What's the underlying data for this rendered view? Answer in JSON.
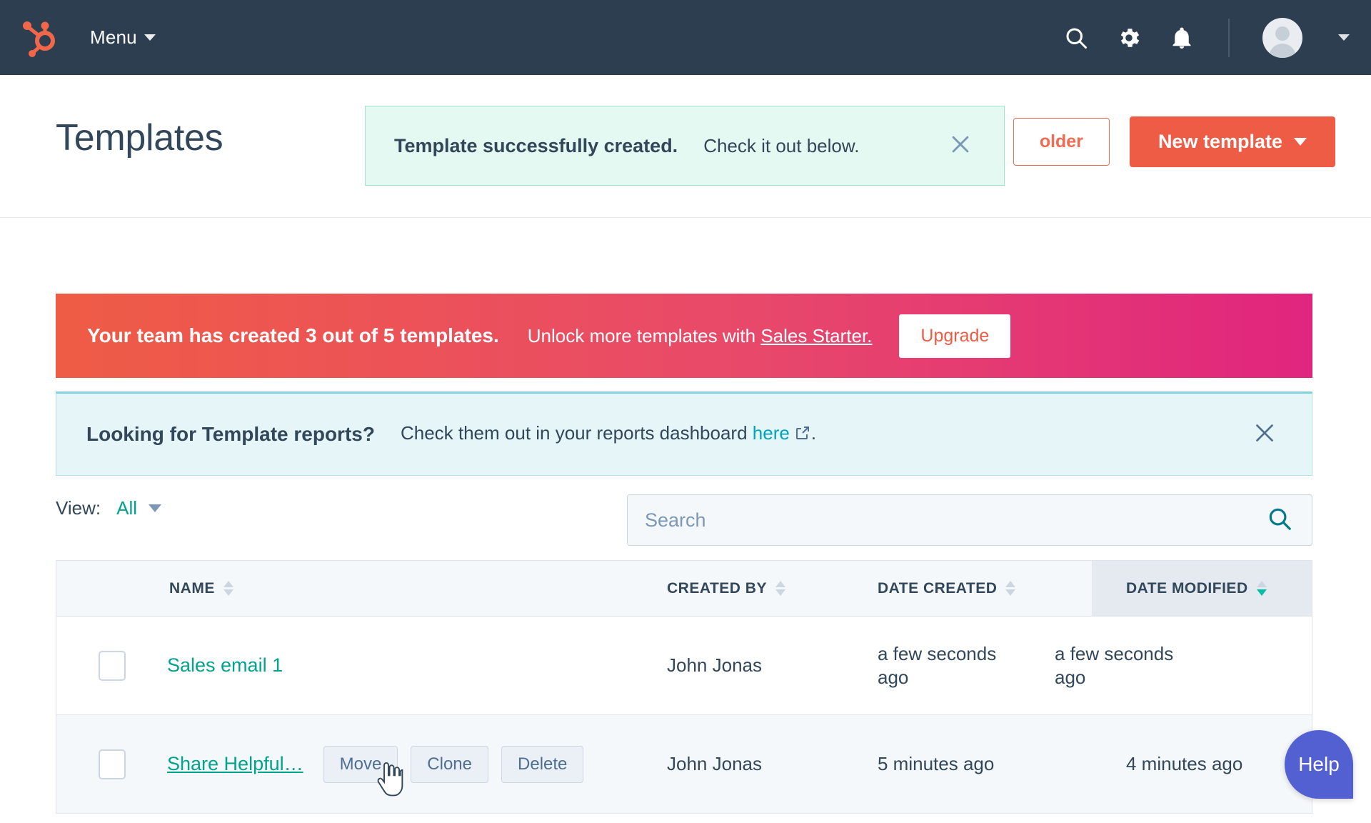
{
  "topnav": {
    "logo": "hubspot-sprocket-logo",
    "menu_label": "Menu",
    "icons": [
      "search-icon",
      "gear-icon",
      "bell-icon"
    ],
    "avatar": "user-avatar"
  },
  "header": {
    "title": "Templates",
    "new_folder_label": "older",
    "new_template_label": "New template"
  },
  "toast": {
    "strong": "Template successfully created.",
    "message": "Check it out below."
  },
  "promo": {
    "strong": "Your team has created 3 out of 5 templates.",
    "text": "Unlock more templates with",
    "link": "Sales Starter.",
    "button": "Upgrade"
  },
  "info": {
    "strong": "Looking for Template reports?",
    "text": "Check them out in your reports dashboard",
    "link": "here",
    "suffix": "."
  },
  "filters": {
    "view_label": "View:",
    "view_value": "All",
    "search_placeholder": "Search",
    "search_value": ""
  },
  "table": {
    "columns": [
      {
        "label": "NAME",
        "sort": "none"
      },
      {
        "label": "CREATED BY",
        "sort": "none"
      },
      {
        "label": "DATE CREATED",
        "sort": "none"
      },
      {
        "label": "DATE MODIFIED",
        "sort": "desc"
      }
    ],
    "rows": [
      {
        "name": "Sales email 1",
        "created_by": "John Jonas",
        "date_created": "a few seconds ago",
        "date_modified": "a few seconds ago"
      },
      {
        "name": "Share Helpful…",
        "created_by": "John Jonas",
        "date_created": "5 minutes ago",
        "date_modified": "4 minutes ago"
      }
    ],
    "row_actions": [
      "Move",
      "Clone",
      "Delete"
    ]
  },
  "help": {
    "label": "Help"
  },
  "colors": {
    "nav_bg": "#2d3e50",
    "brand_orange": "#ef5c45",
    "teal": "#00a38c",
    "link_teal": "#00a4bd",
    "toast_bg": "#e5f9f3",
    "info_bg": "#e5f5f8",
    "help_purple": "#5260d1",
    "sort_active": "#00bda5"
  }
}
